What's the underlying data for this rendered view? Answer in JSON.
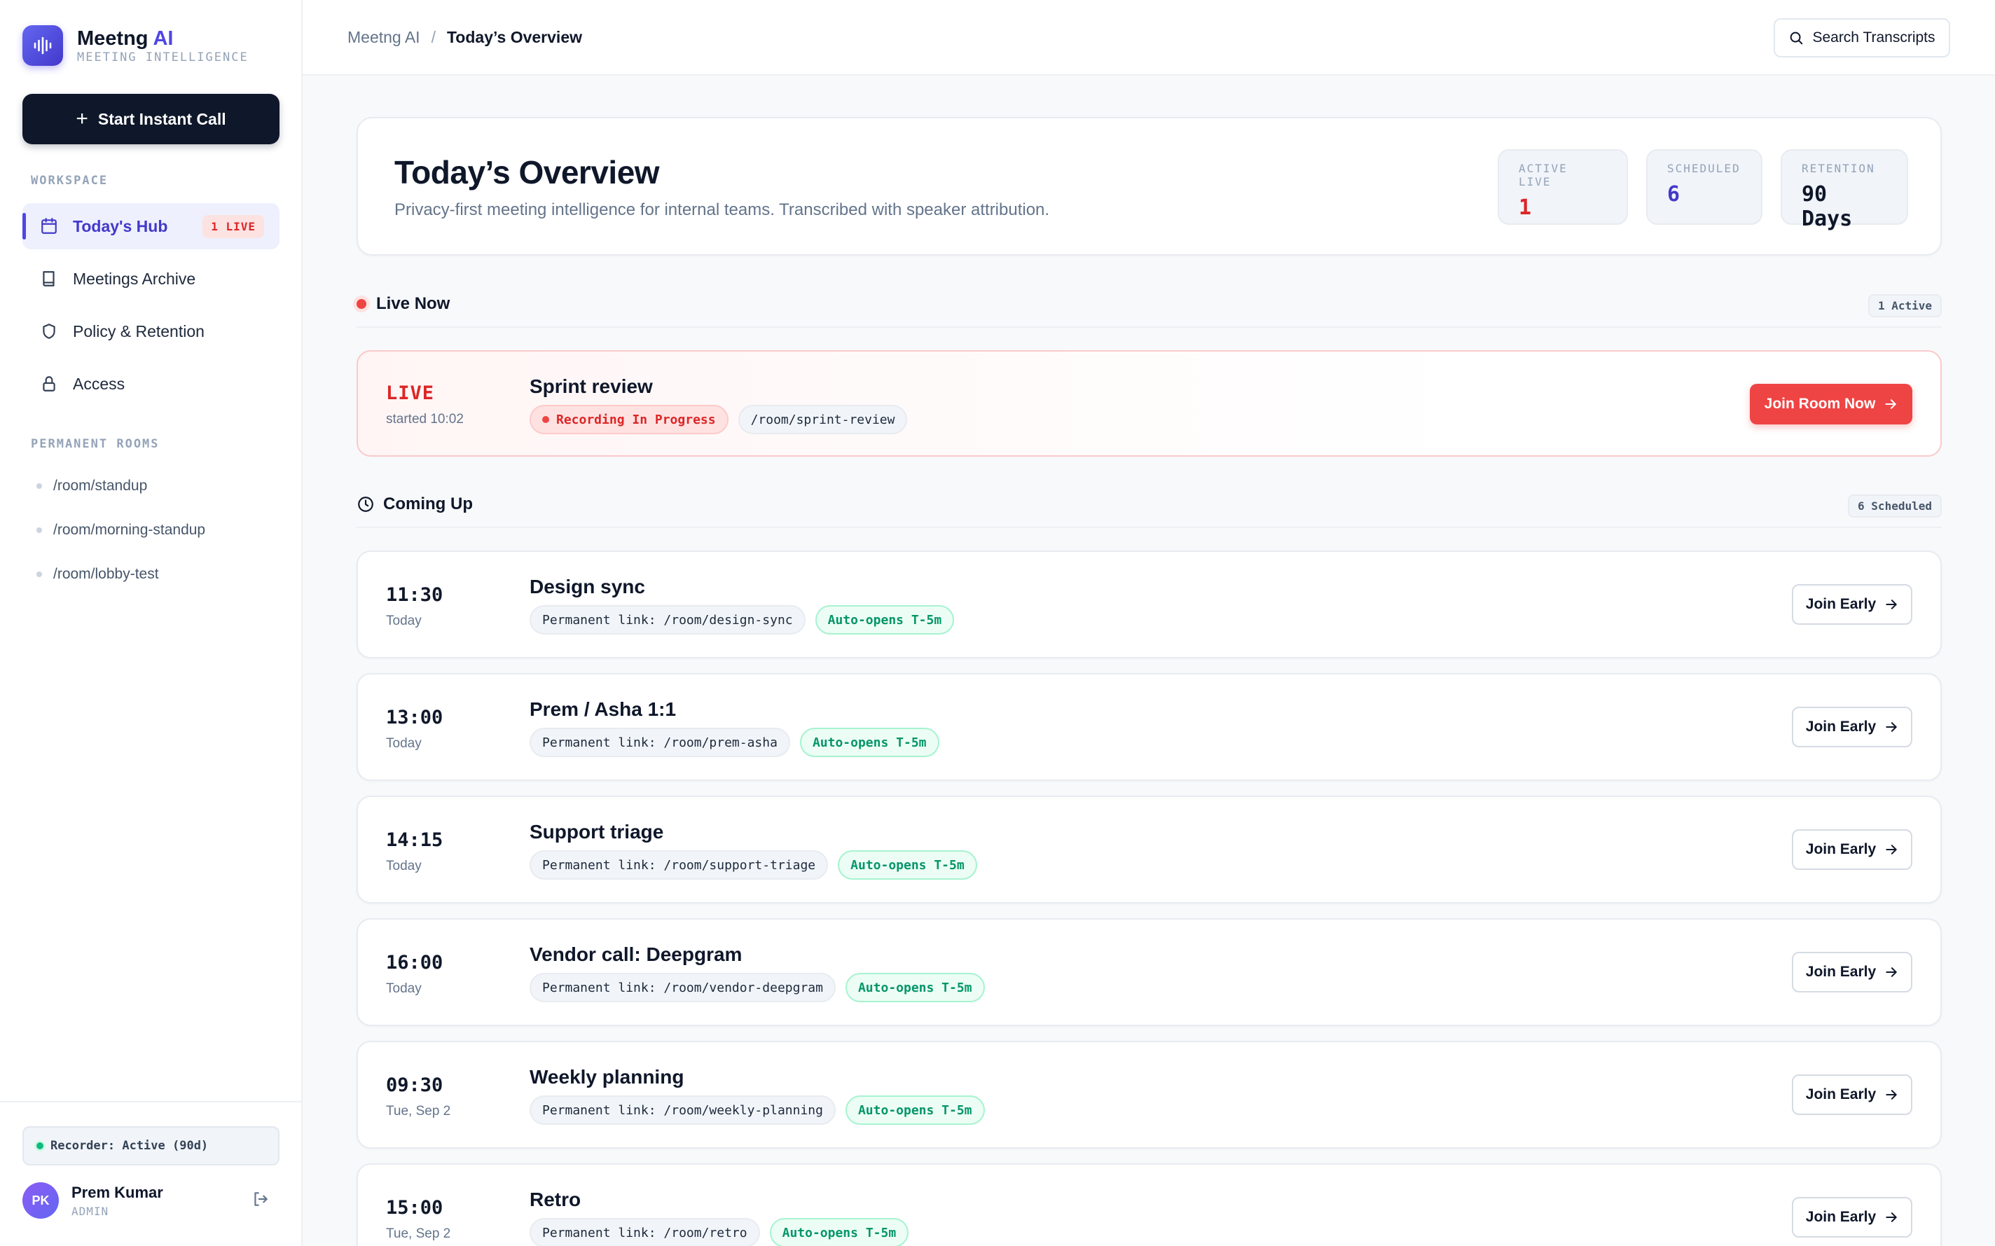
{
  "brand": {
    "name": "Meetng",
    "name_accent": "AI",
    "subtitle": "MEETING INTELLIGENCE",
    "accent_color": "#4f46e5"
  },
  "sidebar": {
    "start_call_label": "Start Instant Call",
    "workspace_label": "WORKSPACE",
    "nav": [
      {
        "label": "Today's Hub",
        "icon": "calendar-icon",
        "active": true,
        "badge": "1 LIVE"
      },
      {
        "label": "Meetings Archive",
        "icon": "book-icon"
      },
      {
        "label": "Policy & Retention",
        "icon": "shield-icon"
      },
      {
        "label": "Access",
        "icon": "lock-icon"
      }
    ],
    "rooms_label": "PERMANENT ROOMS",
    "rooms": [
      "/room/standup",
      "/room/morning-standup",
      "/room/lobby-test"
    ],
    "recorder_status": "Recorder: Active (90d)",
    "user": {
      "initials": "PK",
      "name": "Prem Kumar",
      "role": "ADMIN"
    }
  },
  "topbar": {
    "breadcrumb_root": "Meetng AI",
    "breadcrumb_sep": "/",
    "breadcrumb_current": "Today’s Overview",
    "search_label": "Search Transcripts"
  },
  "overview": {
    "title": "Today’s Overview",
    "subtitle": "Privacy-first meeting intelligence for internal teams. Transcribed with speaker attribution.",
    "stats": [
      {
        "label": "ACTIVE LIVE",
        "value": "1",
        "color": "#dc2626"
      },
      {
        "label": "SCHEDULED",
        "value": "6",
        "color": "#4338ca"
      },
      {
        "label": "RETENTION",
        "value": "90 Days",
        "color": "#0f172a"
      }
    ]
  },
  "live_section": {
    "title": "Live Now",
    "badge": "1 Active",
    "meeting": {
      "tag": "LIVE",
      "started": "started 10:02",
      "title": "Sprint review",
      "status_chip": "Recording In Progress",
      "room": "/room/sprint-review",
      "join_label": "Join Room Now"
    }
  },
  "upcoming_section": {
    "title": "Coming Up",
    "badge": "6 Scheduled",
    "join_label": "Join Early",
    "meetings": [
      {
        "time": "11:30",
        "day": "Today",
        "title": "Design sync",
        "link": "Permanent link: /room/design-sync",
        "auto": "Auto-opens T-5m"
      },
      {
        "time": "13:00",
        "day": "Today",
        "title": "Prem / Asha 1:1",
        "link": "Permanent link: /room/prem-asha",
        "auto": "Auto-opens T-5m"
      },
      {
        "time": "14:15",
        "day": "Today",
        "title": "Support triage",
        "link": "Permanent link: /room/support-triage",
        "auto": "Auto-opens T-5m"
      },
      {
        "time": "16:00",
        "day": "Today",
        "title": "Vendor call: Deepgram",
        "link": "Permanent link: /room/vendor-deepgram",
        "auto": "Auto-opens T-5m"
      },
      {
        "time": "09:30",
        "day": "Tue, Sep 2",
        "title": "Weekly planning",
        "link": "Permanent link: /room/weekly-planning",
        "auto": "Auto-opens T-5m"
      },
      {
        "time": "15:00",
        "day": "Tue, Sep 2",
        "title": "Retro",
        "link": "Permanent link: /room/retro",
        "auto": "Auto-opens T-5m"
      }
    ]
  }
}
